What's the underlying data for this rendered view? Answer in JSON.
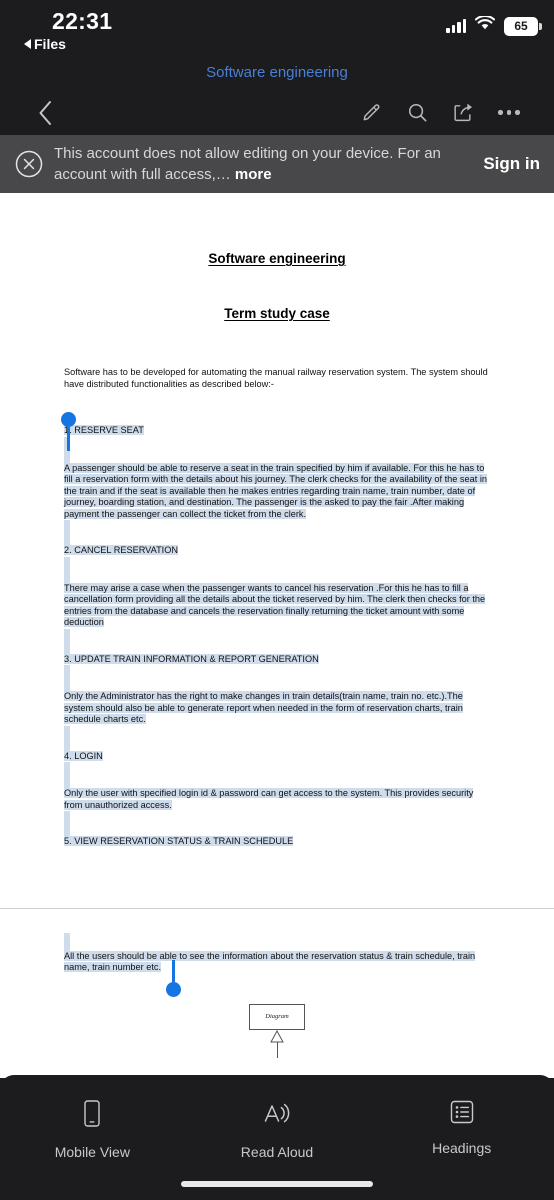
{
  "status_bar": {
    "time": "22:31",
    "back_app": "Files",
    "signal_icon": "cellular-signal-icon",
    "wifi_icon": "wifi-icon",
    "battery_level": "65"
  },
  "header": {
    "doc_title": "Software engineering",
    "back_icon": "chevron-left-icon",
    "edit_icon": "pencil-icon",
    "search_icon": "search-icon",
    "share_icon": "share-icon",
    "more_icon": "ellipsis-icon",
    "title_color": "#4a7fd4"
  },
  "banner": {
    "close_icon": "close-circle-icon",
    "message": "This account does not allow editing on your device. For an account with full access,…",
    "more_label": "more",
    "signin_label": "Sign in",
    "background": "#48484a"
  },
  "document": {
    "title": "Software engineering",
    "subtitle": "Term study case",
    "intro": "Software has to be developed for automating the manual railway reservation system. The system should have distributed functionalities as described below:-",
    "sections": [
      {
        "heading": "1. RESERVE SEAT",
        "body": "A passenger should be able to reserve a seat in the train specified by him if available. For this he has to fill a reservation form with the details about his journey. The clerk checks for the availability of the seat in the train and if the seat is available then he makes entries regarding train name, train number, date of journey, boarding station, and destination. The passenger is the asked to pay the fair .After making payment the passenger can collect the ticket from the clerk."
      },
      {
        "heading": "2. CANCEL RESERVATION",
        "body": "There may arise a case when the passenger wants to cancel his reservation .For this he has to fill a cancellation form providing all the details about the ticket reserved by him. The clerk then checks for the entries from the database and cancels the reservation finally returning the ticket amount with some deduction"
      },
      {
        "heading": "3. UPDATE TRAIN INFORMATION & REPORT GENERATION",
        "body": "Only the Administrator has the right to make changes in train details(train name, train no. etc.).The system should also be able to generate report when needed in the form of reservation charts, train schedule charts etc."
      },
      {
        "heading": "4. LOGIN",
        "body": "Only the user with specified login id & password can get access to the system. This provides security from unauthorized access."
      },
      {
        "heading": "5. VIEW RESERVATION STATUS & TRAIN SCHEDULE",
        "body": ""
      }
    ],
    "page2_body": "All the users should be able to see the information about the reservation status & train schedule, train name, train number etc.",
    "uml_box_label": "Diagram",
    "selection_highlight_color": "#cfdcec",
    "selection_handle_color": "#1675e0"
  },
  "tabbar": {
    "items": [
      {
        "label": "Mobile View",
        "icon": "phone-icon"
      },
      {
        "label": "Read Aloud",
        "icon": "read-aloud-icon"
      },
      {
        "label": "Headings",
        "icon": "list-icon"
      }
    ]
  }
}
